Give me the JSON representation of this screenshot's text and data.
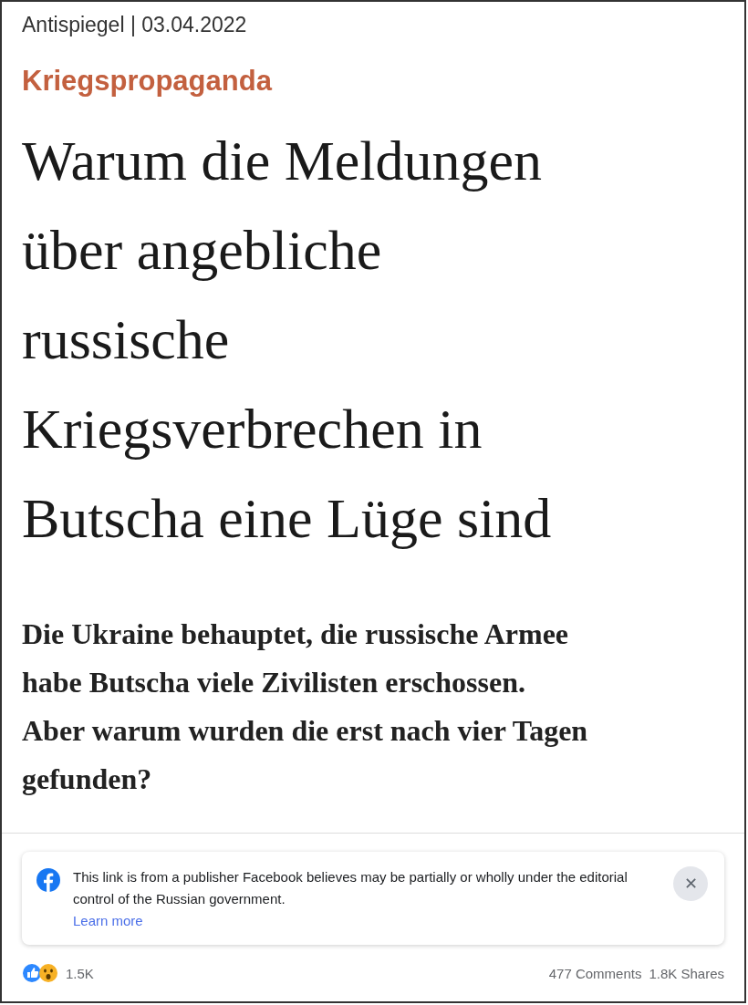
{
  "source_line": "Antispiegel | 03.04.2022",
  "category": "Kriegspropaganda",
  "headline_lines": [
    "Warum die Meldungen",
    "über angebliche",
    "russische",
    "Kriegsverbrechen in",
    "Butscha eine Lüge sind"
  ],
  "subtitle_lines": [
    "Die Ukraine behauptet, die russische Armee",
    "habe Butscha viele Zivilisten erschossen.",
    "Aber warum wurden die erst nach vier Tagen",
    "gefunden?"
  ],
  "notice": {
    "text": "This link is from a publisher Facebook believes may be partially or wholly under the editorial control of the Russian government.",
    "link": "Learn more",
    "close": "✕"
  },
  "footer": {
    "reactions": "1.5K",
    "comments": "477 Comments",
    "shares": "1.8K Shares"
  }
}
